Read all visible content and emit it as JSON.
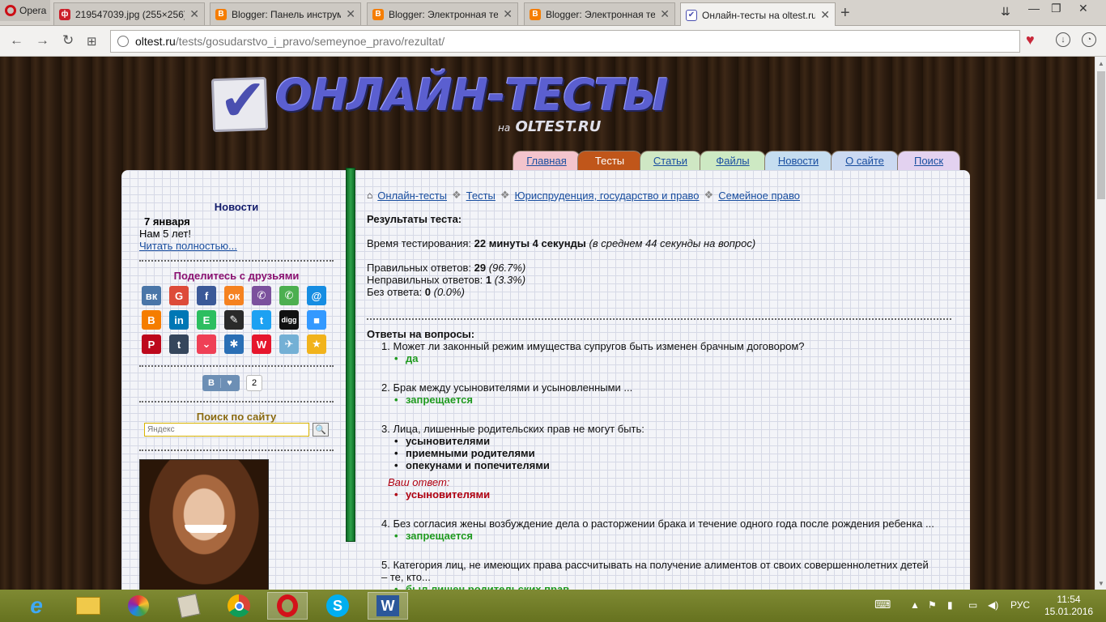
{
  "browser": {
    "menu_label": "Opera",
    "tabs": [
      {
        "title": "219547039.jpg (255×256)",
        "favicon_color": "#cc1f2a",
        "favicon_glyph": "ф"
      },
      {
        "title": "Blogger: Панель инструм",
        "favicon_color": "#f57d00",
        "favicon_glyph": "B"
      },
      {
        "title": "Blogger: Электронная тет",
        "favicon_color": "#f57d00",
        "favicon_glyph": "B"
      },
      {
        "title": "Blogger: Электронная тет",
        "favicon_color": "#f57d00",
        "favicon_glyph": "B"
      },
      {
        "title": "Онлайн-тесты на oltest.ru",
        "favicon_color": "#4a4fb0",
        "favicon_glyph": "✔"
      }
    ],
    "url_domain": "oltest.ru",
    "url_path": "/tests/gosudarstvo_i_pravo/semeynoe_pravo/rezultat/"
  },
  "site": {
    "logo_title": "ОНЛАЙН-ТЕСТЫ",
    "logo_sub_prefix": "на",
    "logo_sub_domain": "OLTEST.RU",
    "nav": [
      {
        "label": "Главная",
        "color": "#f3c4cc"
      },
      {
        "label": "Тесты",
        "color": "#c0561a",
        "current": true
      },
      {
        "label": "Статьи",
        "color": "#cfe7c4"
      },
      {
        "label": "Файлы",
        "color": "#cde9c3"
      },
      {
        "label": "Новости",
        "color": "#c5ddf0"
      },
      {
        "label": "О сайте",
        "color": "#cbd9f1"
      },
      {
        "label": "Поиск",
        "color": "#e3d2f0"
      }
    ]
  },
  "sidebar": {
    "news_heading": "Новости",
    "news_date": "7 января",
    "news_text": "Нам 5 лет!",
    "news_link": "Читать полностью...",
    "share_heading": "Поделитесь с друзьями",
    "social_icons": [
      {
        "name": "vk-icon",
        "glyph": "вк",
        "color": "#4a76a8"
      },
      {
        "name": "google-icon",
        "glyph": "G",
        "color": "#dd4b39"
      },
      {
        "name": "facebook-icon",
        "glyph": "f",
        "color": "#3b5998"
      },
      {
        "name": "odnoklassniki-icon",
        "glyph": "ок",
        "color": "#f58220"
      },
      {
        "name": "viber-icon",
        "glyph": "✆",
        "color": "#7b519d"
      },
      {
        "name": "whatsapp-icon",
        "glyph": "✆",
        "color": "#4caf50"
      },
      {
        "name": "moimir-icon",
        "glyph": "@",
        "color": "#168de2"
      },
      {
        "name": "blogger-icon",
        "glyph": "B",
        "color": "#f57d00"
      },
      {
        "name": "linkedin-icon",
        "glyph": "in",
        "color": "#0077b5"
      },
      {
        "name": "evernote-icon",
        "glyph": "E",
        "color": "#2dbe60"
      },
      {
        "name": "livejournal-icon",
        "glyph": "✎",
        "color": "#2a2a2a"
      },
      {
        "name": "twitter-icon",
        "glyph": "t",
        "color": "#1da1f2"
      },
      {
        "name": "digg-icon",
        "glyph": "digg",
        "color": "#111111"
      },
      {
        "name": "delicious-icon",
        "glyph": "■",
        "color": "#3399ff"
      },
      {
        "name": "pinterest-icon",
        "glyph": "P",
        "color": "#bd081c"
      },
      {
        "name": "tumblr-icon",
        "glyph": "t",
        "color": "#35465c"
      },
      {
        "name": "pocket-icon",
        "glyph": "⌄",
        "color": "#ef4056"
      },
      {
        "name": "liveinternet-icon",
        "glyph": "✱",
        "color": "#2a6fb5"
      },
      {
        "name": "weibo-icon",
        "glyph": "W",
        "color": "#e6162d"
      },
      {
        "name": "surfingbird-icon",
        "glyph": "✈",
        "color": "#74b0d5"
      },
      {
        "name": "bookmarks-icon",
        "glyph": "★",
        "color": "#f1b31c"
      }
    ],
    "like_label": "В",
    "like_count": "2",
    "search_heading": "Поиск по сайту",
    "search_placeholder": "Яндекс"
  },
  "main": {
    "breadcrumbs": [
      "Онлайн-тесты",
      "Тесты",
      "Юриспруденция, государство и право",
      "Семейное право"
    ],
    "results_heading": "Результаты теста:",
    "time_label": "Время тестирования:",
    "time_value": "22 минуты 4 секунды",
    "time_avg": "(в среднем 44 секунды на вопрос)",
    "correct_label": "Правильных ответов:",
    "correct_value": "29",
    "correct_pct": "(96.7%)",
    "wrong_label": "Неправильных ответов:",
    "wrong_value": "1",
    "wrong_pct": "(3.3%)",
    "none_label": "Без ответа:",
    "none_value": "0",
    "none_pct": "(0.0%)",
    "answers_heading": "Ответы на вопросы:",
    "questions": [
      {
        "num": "1.",
        "text": "Может ли законный режим имущества супругов быть изменен брачным договором?",
        "answer": "да"
      },
      {
        "num": "2.",
        "text": "Брак между усыновителями и усыновленными ...",
        "answer": "запрещается"
      },
      {
        "num": "3.",
        "text": "Лица, лишенные родительских прав не могут быть:",
        "options": [
          "усыновителями",
          "приемными родителями",
          "опекунами и попечителями"
        ],
        "your_label": "Ваш ответ:",
        "your_answer": "усыновителями"
      },
      {
        "num": "4.",
        "text": "Без согласия жены возбуждение дела о расторжении брака и течение одного года после рождения ребенка ...",
        "answer": "запрещается"
      },
      {
        "num": "5.",
        "text": "Категория лиц, не имеющих права рассчитывать на получение алиментов от своих совершеннолетних детей",
        "text2": "– те, кто...",
        "answer": "был лишен родительских прав"
      }
    ]
  },
  "taskbar": {
    "lang": "РУС",
    "time": "11:54",
    "date": "15.01.2016"
  }
}
